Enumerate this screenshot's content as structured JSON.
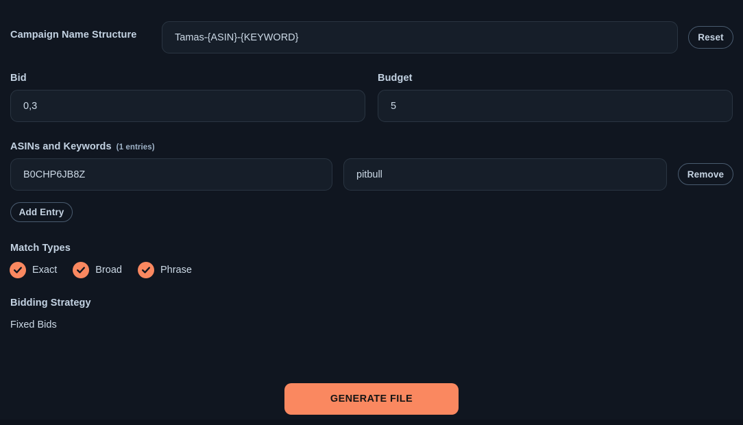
{
  "theme": {
    "background": "#101620",
    "field_background": "#161e29",
    "field_border": "#2a3542",
    "label_color": "#c3d2e2",
    "accent": "#fa8860"
  },
  "campaign": {
    "label": "Campaign Name Structure",
    "value": "Tamas-{ASIN}-{KEYWORD}",
    "placeholder": "Campaign name structure",
    "reset_label": "Reset"
  },
  "bid": {
    "label": "Bid",
    "value": "0,3",
    "placeholder": "Bid"
  },
  "budget": {
    "label": "Budget",
    "value": "5",
    "placeholder": "Budget"
  },
  "entries_section": {
    "label": "ASINs and Keywords",
    "count_label": "(1 entries)",
    "asin_placeholder": "ASIN",
    "keyword_placeholder": "Keyword",
    "remove_label": "Remove",
    "add_entry_label": "Add Entry",
    "rows": [
      {
        "asin": "B0CHP6JB8Z",
        "keyword": "pitbull"
      }
    ]
  },
  "match_types": {
    "label": "Match Types",
    "items": [
      {
        "label": "Exact",
        "checked": true,
        "icon": "check-icon"
      },
      {
        "label": "Broad",
        "checked": true,
        "icon": "check-icon"
      },
      {
        "label": "Phrase",
        "checked": true,
        "icon": "check-icon"
      }
    ]
  },
  "bidding_strategy": {
    "label": "Bidding Strategy",
    "value": "Fixed Bids"
  },
  "generate": {
    "label": "GENERATE FILE"
  }
}
